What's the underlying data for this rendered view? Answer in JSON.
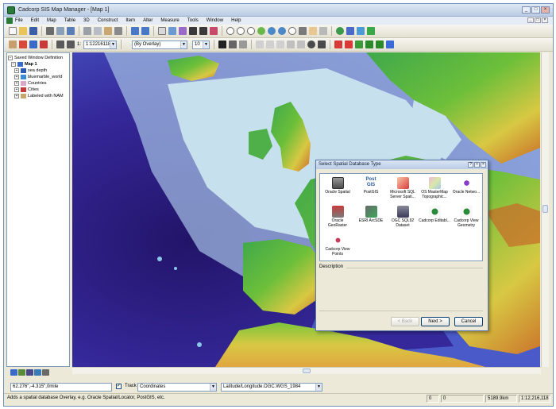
{
  "app": {
    "title": "Cadcorp SIS Map Manager - [Map 1]",
    "window_buttons": [
      "_",
      "□",
      "×"
    ],
    "mdi_buttons": [
      "_",
      "□",
      "×"
    ]
  },
  "menu": [
    "File",
    "Edit",
    "Map",
    "Table",
    "3D",
    "Construct",
    "Item",
    "Alter",
    "Measure",
    "Tools",
    "Window",
    "Help"
  ],
  "toolbar2": {
    "scale_value": "1:12216118",
    "overlay_select": "(By Overlay)",
    "size_select": "10"
  },
  "tree": {
    "root": "Saved Window Definition",
    "map": "Map 1",
    "layers": [
      "sea depth",
      "bluemarble_world",
      "Countries",
      "Cities",
      "Labeled with NAM"
    ]
  },
  "dialog": {
    "title": "Select Spatial Database Type",
    "items": [
      {
        "label": "Oracle Spatial",
        "icon": "oracle-spatial-icon"
      },
      {
        "label": "PostGIS",
        "icon": "postgis-icon",
        "logo_text": "Post GIS"
      },
      {
        "label": "Microsoft SQL Server Spati...",
        "icon": "mssql-icon"
      },
      {
        "label": "OS MasterMap Topographic...",
        "icon": "os-mastermap-icon"
      },
      {
        "label": "Oracle Netwo...",
        "icon": "oracle-network-icon"
      },
      {
        "label": "Oracle GeoRaster",
        "icon": "georaster-icon"
      },
      {
        "label": "ESRI ArcSDE",
        "icon": "arcsde-icon"
      },
      {
        "label": "OGC SQL92 Dataset",
        "icon": "ogc-sql92-icon"
      },
      {
        "label": "Cadcorp Editabl...",
        "icon": "cadcorp-editable-icon"
      },
      {
        "label": "Cadcorp View Geometry",
        "icon": "cadcorp-view-geometry-icon"
      },
      {
        "label": "Cadcorp View Points",
        "icon": "cadcorp-view-points-icon"
      }
    ],
    "description_label": "Description",
    "back_label": "< Back",
    "next_label": "Next >",
    "cancel_label": "Cancel"
  },
  "bottom": {
    "coord_value": "62.276\",-4.315\",0mile",
    "track_label": "Track",
    "track_checked": true,
    "coord_mode": "Coordinates",
    "crs_select": "Latitude/Longitude.OGC.WGS_1984"
  },
  "status": {
    "message": "Adds a spatial database Overlay, e.g. Oracle Spatial/Locator, PostGIS, etc.",
    "count1": "0",
    "count2": "0",
    "distance": "5189.9km",
    "scale": "1:12,216,118"
  },
  "colors": {
    "deep_sea": "#2d1b7a",
    "shallow_sea": "#c7e0ee",
    "lowland": "#3fa84a",
    "upland": "#d8c843",
    "mountain": "#c96a28"
  }
}
